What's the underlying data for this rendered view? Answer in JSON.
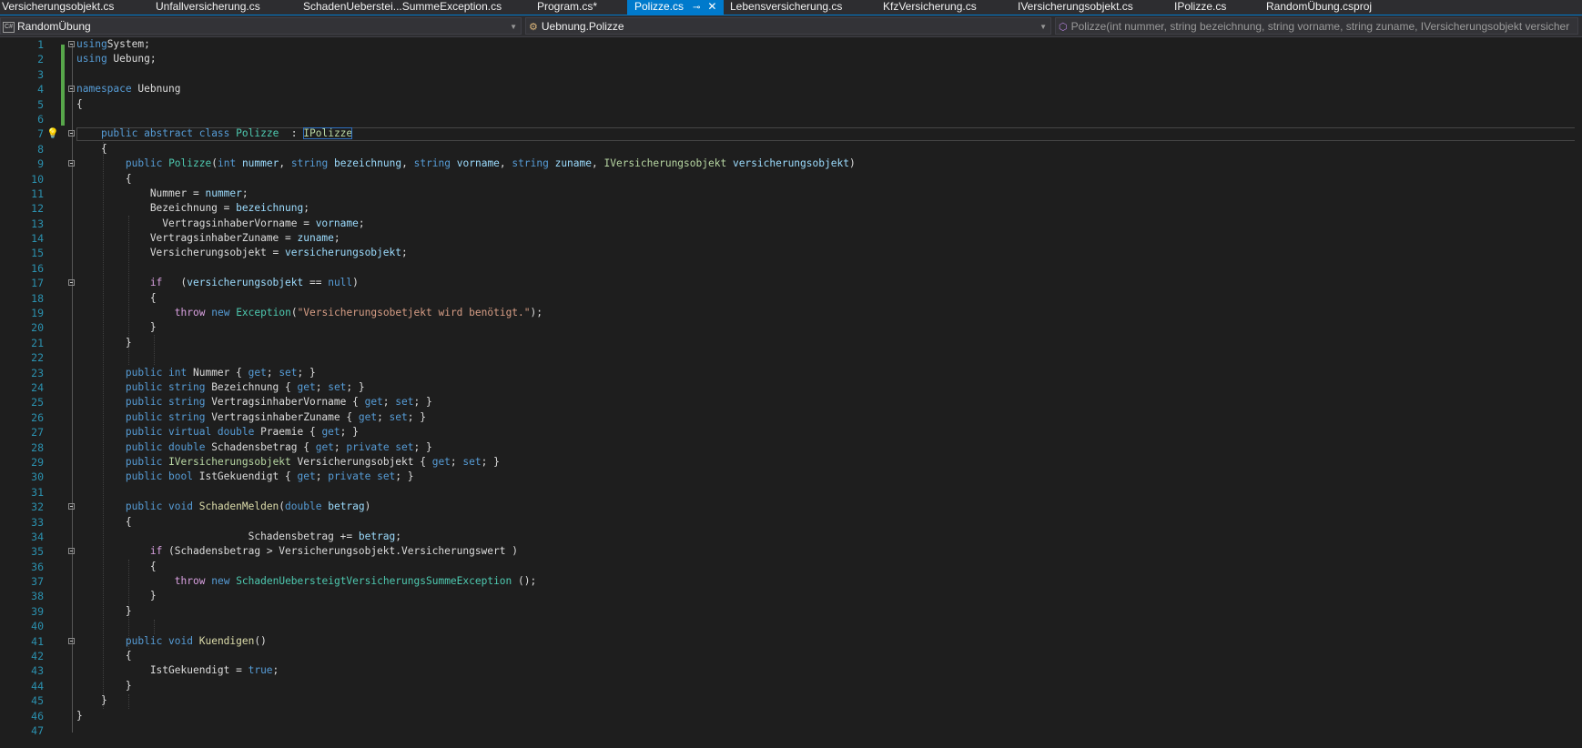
{
  "tabs": [
    {
      "label": "Versicherungsobjekt.cs",
      "active": false
    },
    {
      "label": "Unfallversicherung.cs",
      "active": false
    },
    {
      "label": "SchadenUeberstei...SummeException.cs",
      "active": false
    },
    {
      "label": "Program.cs*",
      "active": false
    },
    {
      "label": "Polizze.cs",
      "active": true
    },
    {
      "label": "Lebensversicherung.cs",
      "active": false
    },
    {
      "label": "KfzVersicherung.cs",
      "active": false
    },
    {
      "label": "IVersicherungsobjekt.cs",
      "active": false
    },
    {
      "label": "IPolizze.cs",
      "active": false
    },
    {
      "label": "RandomÜbung.csproj",
      "active": false
    }
  ],
  "tab_icons": {
    "pin": "pin-icon",
    "close": "close-icon"
  },
  "navbar": {
    "project": "RandomÜbung",
    "type": "Uebnung.Polizze",
    "member": "Polizze(int nummer, string bezeichnung, string vorname, string zuname, IVersicherungsobjekt versicher"
  },
  "colors": {
    "accent": "#007acc",
    "keyword": "#569cd6",
    "type": "#4ec9b0",
    "interface": "#b8d7a3",
    "string": "#d69d85",
    "method": "#dcdcaa",
    "parameter": "#9cdcfe",
    "control": "#d8a0df",
    "line_number": "#2b91af",
    "background": "#1e1e1e"
  },
  "editor": {
    "line_numbers": [
      "1",
      "2",
      "3",
      "4",
      "5",
      "6",
      "7",
      "8",
      "9",
      "10",
      "11",
      "12",
      "13",
      "14",
      "15",
      "16",
      "17",
      "18",
      "19",
      "20",
      "21",
      "22",
      "23",
      "24",
      "25",
      "26",
      "27",
      "28",
      "29",
      "30",
      "31",
      "32",
      "33",
      "34",
      "35",
      "36",
      "37",
      "38",
      "39",
      "40",
      "41",
      "42",
      "43",
      "44",
      "45",
      "46",
      "47"
    ],
    "code": [
      [
        [
          "k",
          "using"
        ],
        [
          "",
          "System;"
        ]
      ],
      [
        [
          "k",
          "using"
        ],
        [
          "",
          " Uebung;"
        ]
      ],
      [],
      [
        [
          "k",
          "namespace"
        ],
        [
          "",
          " Uebnung"
        ]
      ],
      [
        [
          "",
          "{"
        ]
      ],
      [],
      [
        [
          "",
          "    "
        ],
        [
          "k",
          "public abstract class"
        ],
        [
          "",
          " "
        ],
        [
          "t",
          "Polizze"
        ],
        [
          "",
          "  : "
        ],
        [
          "i",
          "IPolizze"
        ]
      ],
      [
        [
          "",
          "    {"
        ]
      ],
      [
        [
          "",
          "        "
        ],
        [
          "k",
          "public"
        ],
        [
          "",
          " "
        ],
        [
          "t",
          "Polizze"
        ],
        [
          "",
          "("
        ],
        [
          "k",
          "int"
        ],
        [
          "",
          " "
        ],
        [
          "p",
          "nummer"
        ],
        [
          "",
          ", "
        ],
        [
          "k",
          "string"
        ],
        [
          "",
          " "
        ],
        [
          "p",
          "bezeichnung"
        ],
        [
          "",
          ", "
        ],
        [
          "k",
          "string"
        ],
        [
          "",
          " "
        ],
        [
          "p",
          "vorname"
        ],
        [
          "",
          ", "
        ],
        [
          "k",
          "string"
        ],
        [
          "",
          " "
        ],
        [
          "p",
          "zuname"
        ],
        [
          "",
          ", "
        ],
        [
          "i",
          "IVersicherungsobjekt"
        ],
        [
          "",
          " "
        ],
        [
          "p",
          "versicherungsobjekt"
        ],
        [
          "",
          ")"
        ]
      ],
      [
        [
          "",
          "        {"
        ]
      ],
      [
        [
          "",
          "            Nummer = "
        ],
        [
          "p",
          "nummer"
        ],
        [
          "",
          ";"
        ]
      ],
      [
        [
          "",
          "            Bezeichnung = "
        ],
        [
          "p",
          "bezeichnung"
        ],
        [
          "",
          ";"
        ]
      ],
      [
        [
          "",
          "              VertragsinhaberVorname = "
        ],
        [
          "p",
          "vorname"
        ],
        [
          "",
          ";"
        ]
      ],
      [
        [
          "",
          "            VertragsinhaberZuname = "
        ],
        [
          "p",
          "zuname"
        ],
        [
          "",
          ";"
        ]
      ],
      [
        [
          "",
          "            Versicherungsobjekt = "
        ],
        [
          "p",
          "versicherungsobjekt"
        ],
        [
          "",
          ";"
        ]
      ],
      [],
      [
        [
          "",
          "            "
        ],
        [
          "ctl",
          "if"
        ],
        [
          "",
          "   ("
        ],
        [
          "p",
          "versicherungsobjekt"
        ],
        [
          "",
          " == "
        ],
        [
          "k",
          "null"
        ],
        [
          "",
          ")"
        ]
      ],
      [
        [
          "",
          "            {"
        ]
      ],
      [
        [
          "",
          "                "
        ],
        [
          "ctl",
          "throw"
        ],
        [
          "",
          " "
        ],
        [
          "k",
          "new"
        ],
        [
          "",
          " "
        ],
        [
          "t",
          "Exception"
        ],
        [
          "",
          "("
        ],
        [
          "s",
          "\"Versicherungsobetjekt wird benötigt.\""
        ],
        [
          "",
          ");"
        ]
      ],
      [
        [
          "",
          "            }"
        ]
      ],
      [
        [
          "",
          "        }"
        ]
      ],
      [],
      [
        [
          "",
          "        "
        ],
        [
          "k",
          "public int"
        ],
        [
          "",
          " Nummer { "
        ],
        [
          "k",
          "get"
        ],
        [
          "",
          "; "
        ],
        [
          "k",
          "set"
        ],
        [
          "",
          "; }"
        ]
      ],
      [
        [
          "",
          "        "
        ],
        [
          "k",
          "public string"
        ],
        [
          "",
          " Bezeichnung { "
        ],
        [
          "k",
          "get"
        ],
        [
          "",
          "; "
        ],
        [
          "k",
          "set"
        ],
        [
          "",
          "; }"
        ]
      ],
      [
        [
          "",
          "        "
        ],
        [
          "k",
          "public string"
        ],
        [
          "",
          " VertragsinhaberVorname { "
        ],
        [
          "k",
          "get"
        ],
        [
          "",
          "; "
        ],
        [
          "k",
          "set"
        ],
        [
          "",
          "; }"
        ]
      ],
      [
        [
          "",
          "        "
        ],
        [
          "k",
          "public string"
        ],
        [
          "",
          " VertragsinhaberZuname { "
        ],
        [
          "k",
          "get"
        ],
        [
          "",
          "; "
        ],
        [
          "k",
          "set"
        ],
        [
          "",
          "; }"
        ]
      ],
      [
        [
          "",
          "        "
        ],
        [
          "k",
          "public virtual double"
        ],
        [
          "",
          " Praemie { "
        ],
        [
          "k",
          "get"
        ],
        [
          "",
          "; }"
        ]
      ],
      [
        [
          "",
          "        "
        ],
        [
          "k",
          "public double"
        ],
        [
          "",
          " Schadensbetrag { "
        ],
        [
          "k",
          "get"
        ],
        [
          "",
          "; "
        ],
        [
          "k",
          "private set"
        ],
        [
          "",
          "; }"
        ]
      ],
      [
        [
          "",
          "        "
        ],
        [
          "k",
          "public"
        ],
        [
          "",
          " "
        ],
        [
          "i",
          "IVersicherungsobjekt"
        ],
        [
          "",
          " Versicherungsobjekt { "
        ],
        [
          "k",
          "get"
        ],
        [
          "",
          "; "
        ],
        [
          "k",
          "set"
        ],
        [
          "",
          "; }"
        ]
      ],
      [
        [
          "",
          "        "
        ],
        [
          "k",
          "public bool"
        ],
        [
          "",
          " IstGekuendigt { "
        ],
        [
          "k",
          "get"
        ],
        [
          "",
          "; "
        ],
        [
          "k",
          "private set"
        ],
        [
          "",
          "; }"
        ]
      ],
      [],
      [
        [
          "",
          "        "
        ],
        [
          "k",
          "public void"
        ],
        [
          "",
          " "
        ],
        [
          "m",
          "SchadenMelden"
        ],
        [
          "",
          "("
        ],
        [
          "k",
          "double"
        ],
        [
          "",
          " "
        ],
        [
          "p",
          "betrag"
        ],
        [
          "",
          ")"
        ]
      ],
      [
        [
          "",
          "        {"
        ]
      ],
      [
        [
          "",
          "                            Schadensbetrag += "
        ],
        [
          "p",
          "betrag"
        ],
        [
          "",
          ";"
        ]
      ],
      [
        [
          "",
          "            "
        ],
        [
          "ctl",
          "if"
        ],
        [
          "",
          " (Schadensbetrag > Versicherungsobjekt.Versicherungswert )"
        ]
      ],
      [
        [
          "",
          "            {"
        ]
      ],
      [
        [
          "",
          "                "
        ],
        [
          "ctl",
          "throw"
        ],
        [
          "",
          " "
        ],
        [
          "k",
          "new"
        ],
        [
          "",
          " "
        ],
        [
          "t",
          "SchadenUebersteigtVersicherungsSummeException"
        ],
        [
          "",
          " ();"
        ]
      ],
      [
        [
          "",
          "            }"
        ]
      ],
      [
        [
          "",
          "        }"
        ]
      ],
      [],
      [
        [
          "",
          "        "
        ],
        [
          "k",
          "public void"
        ],
        [
          "",
          " "
        ],
        [
          "m",
          "Kuendigen"
        ],
        [
          "",
          "()"
        ]
      ],
      [
        [
          "",
          "        {"
        ]
      ],
      [
        [
          "",
          "            IstGekuendigt = "
        ],
        [
          "k",
          "true"
        ],
        [
          "",
          ";"
        ]
      ],
      [
        [
          "",
          "        }"
        ]
      ],
      [
        [
          "",
          "    }"
        ]
      ],
      [
        [
          "",
          "}"
        ]
      ],
      []
    ],
    "fold_lines": [
      1,
      4,
      7,
      9,
      17,
      32,
      35,
      41
    ],
    "lightbulb_line": 7,
    "icons": {
      "fold": "collapse-icon",
      "lightbulb": "lightbulb-icon",
      "nav_method": "method-icon",
      "nav_class": "class-icon",
      "nav_project": "csharp-project-icon",
      "dropdown": "chevron-down-icon"
    }
  }
}
